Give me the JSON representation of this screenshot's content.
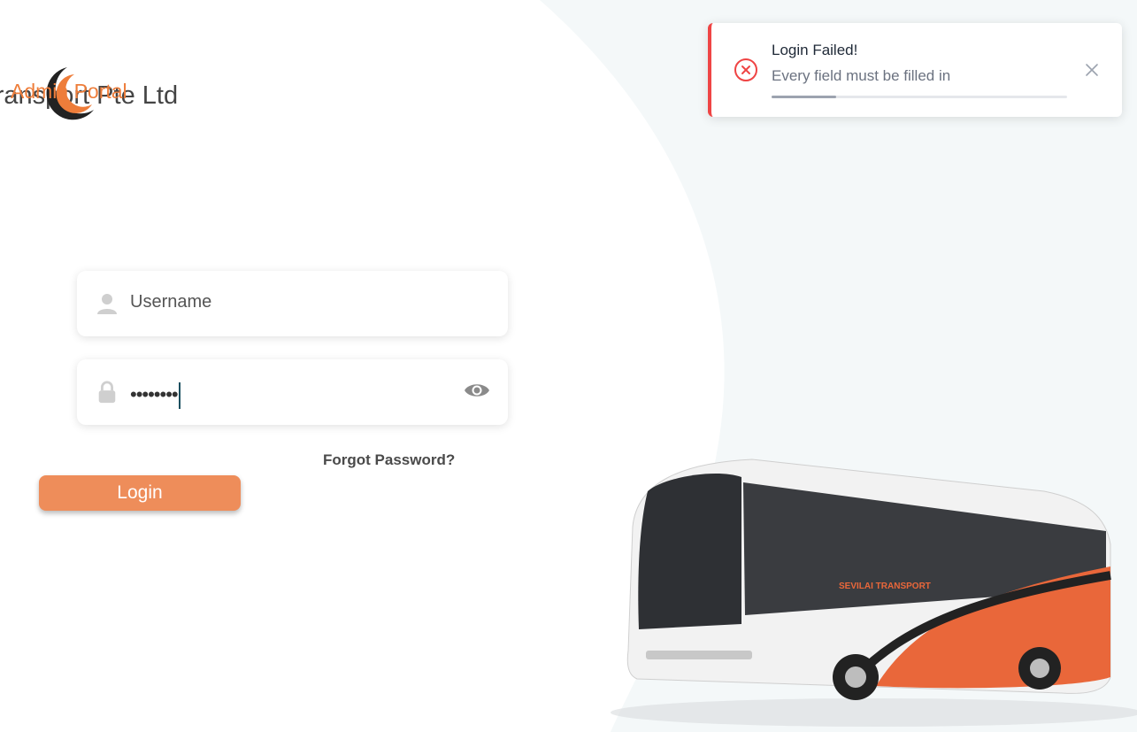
{
  "brand": {
    "company_name": "ai Transport Pte Ltd",
    "portal_label": "Admin Portal",
    "accent": "#ee7d3a"
  },
  "login_form": {
    "username": {
      "placeholder": "Username",
      "icon": "user-icon"
    },
    "password": {
      "value": "••••••••",
      "icon": "lock-icon",
      "toggle_icon": "eye-icon"
    },
    "forgot_label": "Forgot Password?",
    "login_label": "Login"
  },
  "toast": {
    "title": "Login Failed!",
    "message": "Every field must be filled in",
    "progress": 0.22,
    "status_color": "#ef4444",
    "icon": "error-icon",
    "close_icon": "close-icon"
  },
  "bus_image": {
    "brand_text": "SEVILAI TRANSPORT"
  }
}
